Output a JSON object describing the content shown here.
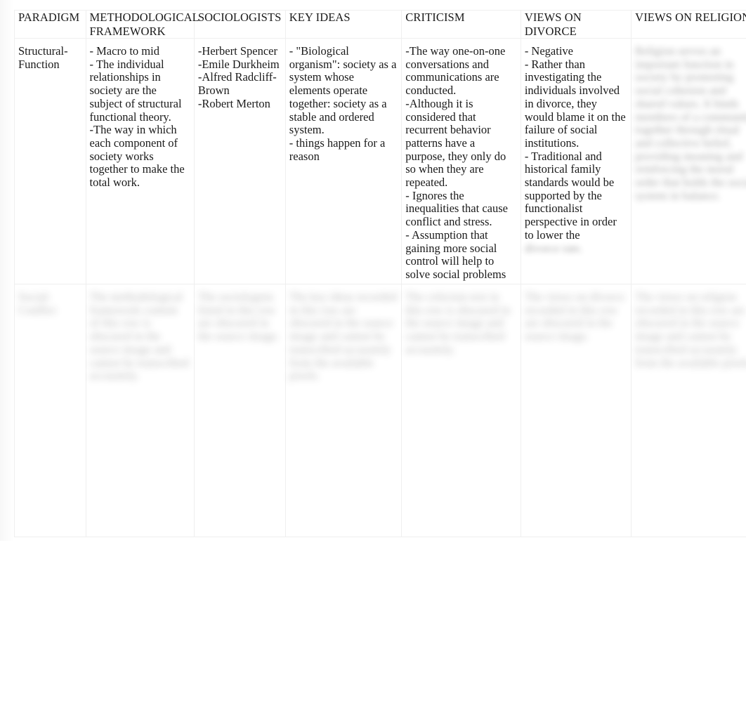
{
  "document": {
    "type": "comparison-table",
    "subject": "Sociological paradigms comparison chart",
    "background_color": "#ffffff",
    "text_color": "#1a1a1a",
    "border_color": "#efefef"
  },
  "table": {
    "headers": [
      "PARADIGM",
      "METHODOLOGICAL FRAMEWORK",
      "SOCIOLOGISTS",
      "KEY IDEAS",
      "CRITICISM",
      "VIEWS ON DIVORCE",
      "VIEWS ON RELIGION"
    ],
    "rows": [
      {
        "row_name": "structural-function",
        "blurred": false,
        "cells": {
          "paradigm": "Structural-Function",
          "framework": "- Macro to mid\n- The individual relationships in society are the subject of structural functional theory.\n-The way in which each component of society works together to make the total work.",
          "sociologists": "-Herbert Spencer\n-Emile Durkheim\n-Alfred Radcliff-Brown\n-Robert Merton",
          "key_ideas": "- \"Biological organism\": society as a system whose elements operate together: society as a stable and ordered system.\n- things happen for a reason",
          "criticism": "-The way one-on-one conversations and communications are conducted.\n-Although it is considered that recurrent behavior patterns have a purpose, they only do so when they are repeated.\n- Ignores the inequalities that cause conflict and stress.\n- Assumption that gaining more social control will help to solve social problems",
          "views_on_divorce": "- Negative\n- Rather than investigating the individuals involved in divorce, they would blame it on the failure of social institutions.\n- Traditional and historical family standards would be supported by the functionalist perspective in order to lower the",
          "views_on_divorce_obscured_tail": "divorce rate.",
          "views_on_religion": "Religion serves an important function in society by promoting social cohesion and shared values. It binds members of a community together through ritual and collective belief, providing meaning and reinforcing the moral order that holds the social system in balance."
        }
      },
      {
        "row_name": "second-paradigm",
        "blurred": true,
        "cells": {
          "paradigm": "Social-Conflict",
          "framework": "The methodological framework content of this row is obscured in the source image and cannot be transcribed accurately.",
          "sociologists": "The sociologists listed in this row are obscured in the source image.",
          "key_ideas": "The key ideas recorded in this row are obscured in the source image and cannot be transcribed accurately from the available pixels.",
          "criticism": "The criticism text in this row is obscured in the source image and cannot be transcribed accurately.",
          "views_on_divorce": "The views on divorce recorded in this row are obscured in the source image.",
          "views_on_religion": "The views on religion recorded in this row are obscured in the source image and cannot be transcribed accurately from the available pixels."
        }
      }
    ]
  },
  "notes": {
    "legibility": "Row 1 is fully legible; the VIEWS ON RELIGION column and the entire second row are blurred/redacted in the screenshot."
  }
}
